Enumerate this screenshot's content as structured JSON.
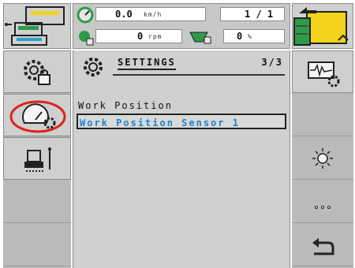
{
  "status": {
    "speed_value": "0.0",
    "speed_unit": "km/h",
    "rpm_value": "0",
    "rpm_unit": "rpm",
    "fill_value": "0",
    "fill_unit": "%",
    "page_counter": "1 / 1"
  },
  "panel": {
    "title": "SETTINGS",
    "page": "3/3",
    "items": [
      {
        "label": "Work Position",
        "selected": false
      },
      {
        "label": "Work Position Sensor 1",
        "selected": true
      }
    ]
  },
  "left_buttons": [
    "settings-lock-icon",
    "gauge-settings-icon",
    "implement-height-icon"
  ],
  "right_buttons": [
    "waveform-settings-icon",
    "brightness-icon",
    "more-icon",
    "back-icon"
  ],
  "colors": {
    "background": "#cfd1cf",
    "selected_text": "#1f7fcf",
    "highlight_ring": "#e02020"
  }
}
